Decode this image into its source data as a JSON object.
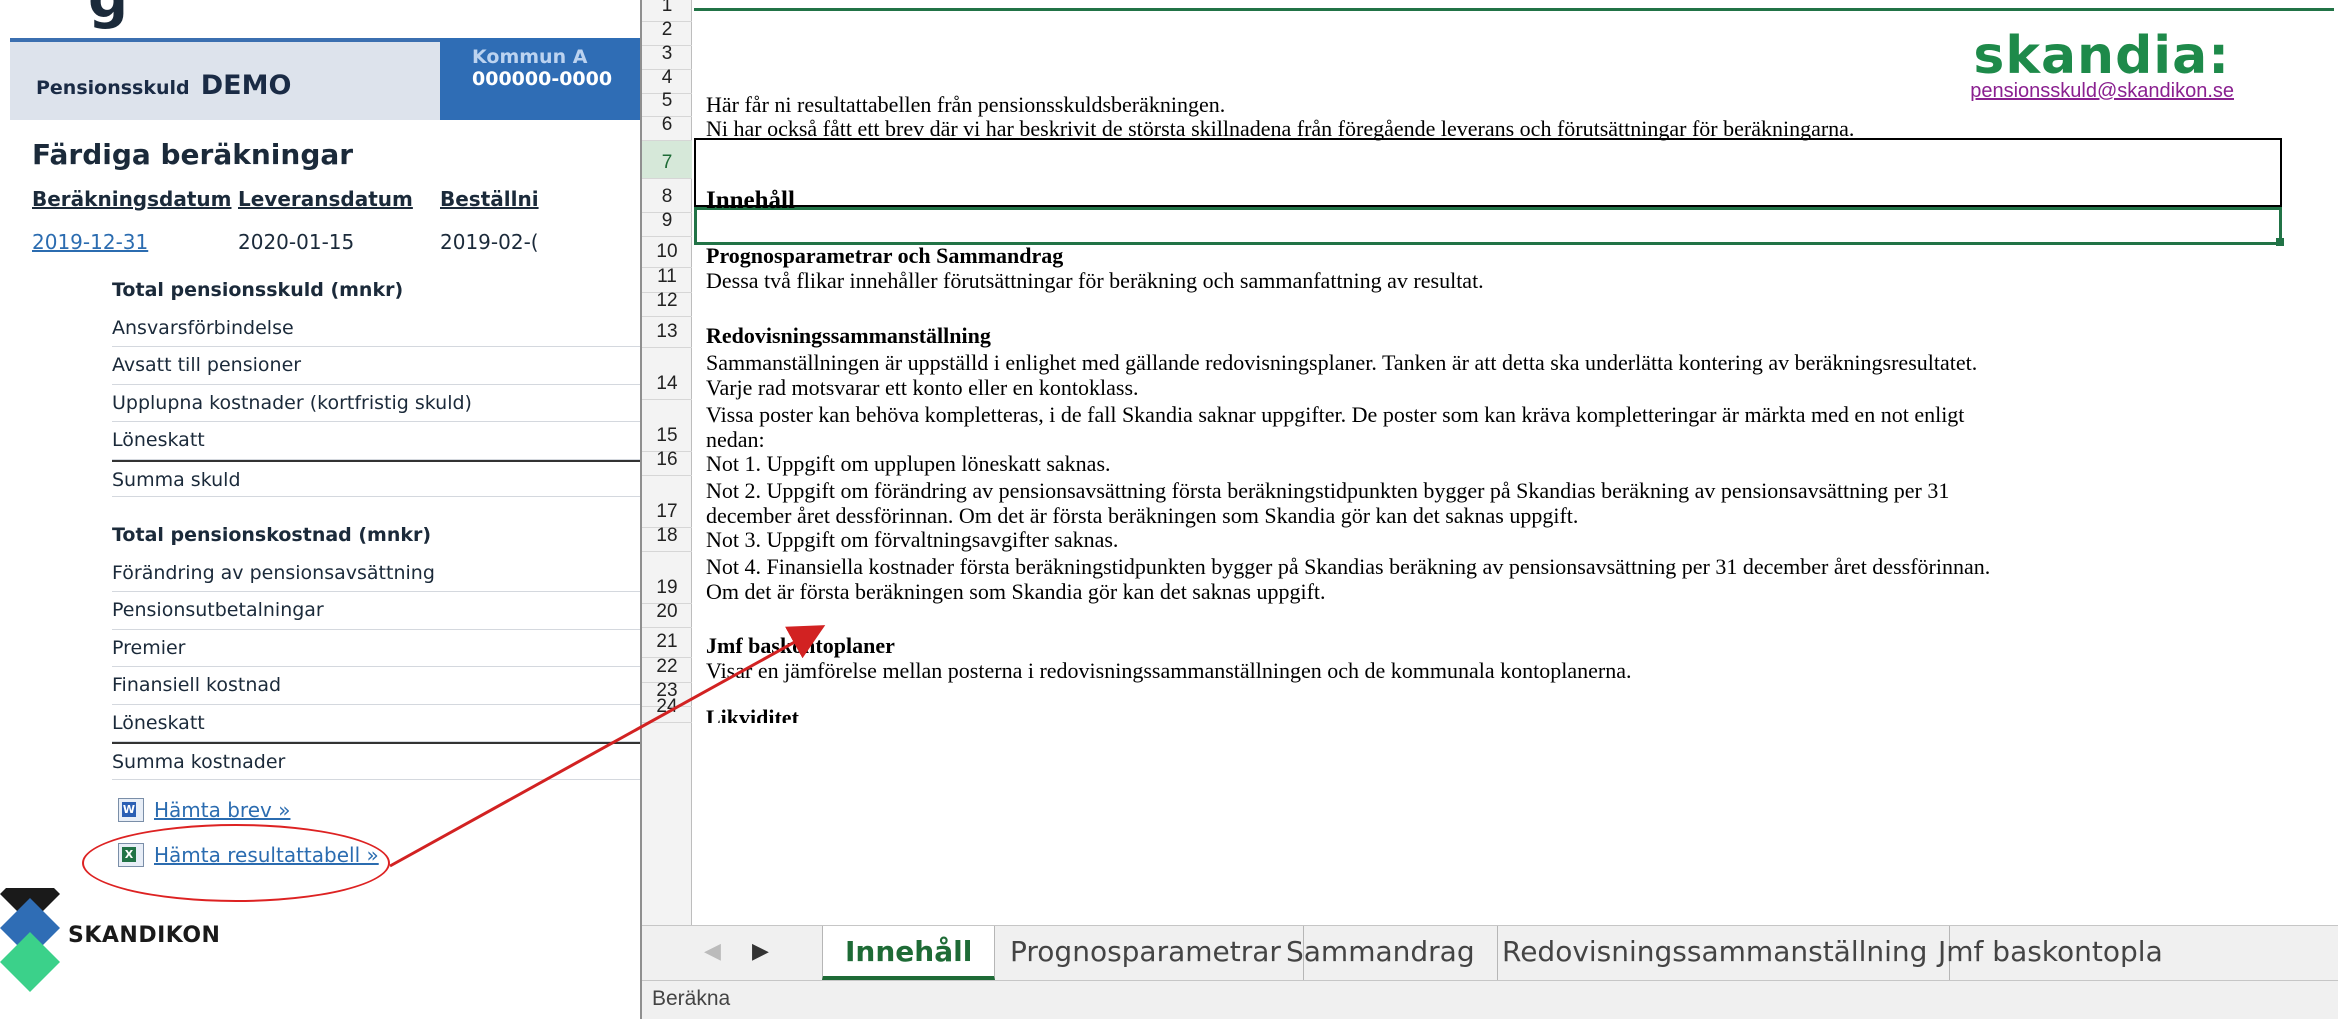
{
  "app": {
    "header_small": "Pensionsskuld",
    "header_large": "DEMO",
    "tab_muni": "Kommun A",
    "tab_id": "000000-0000",
    "section_title": "Färdiga beräkningar",
    "columns": [
      "Beräkningsdatum",
      "Leveransdatum",
      "Beställni"
    ],
    "row": {
      "calc_date": "2019-12-31",
      "delivery_date": "2020-01-15",
      "order_date": "2019-02-("
    },
    "debt": {
      "title": "Total pensionsskuld (mnkr)",
      "items": [
        "Ansvarsförbindelse",
        "Avsatt till pensioner",
        "Upplupna kostnader (kortfristig skuld)",
        "Löneskatt"
      ],
      "total": "Summa skuld"
    },
    "cost": {
      "title": "Total pensionskostnad (mnkr)",
      "items": [
        "Förändring av pensionsavsättning",
        "Pensionsutbetalningar",
        "Premier",
        "Finansiell kostnad",
        "Löneskatt"
      ],
      "total": "Summa kostnader"
    },
    "link_letter": "Hämta brev »",
    "link_table": "Hämta resultattabell »",
    "company_logo_text": "SKANDIKON"
  },
  "sheet": {
    "brand": "skandia:",
    "email": "pensionsskuld@skandikon.se",
    "rows": [
      {
        "n": "1",
        "text": ""
      },
      {
        "n": "2",
        "text": ""
      },
      {
        "n": "3",
        "text": ""
      },
      {
        "n": "4",
        "text": ""
      },
      {
        "n": "5",
        "text": "Här får ni resultattabellen från pensionsskuldsberäkningen."
      },
      {
        "n": "6",
        "text": "Ni har också fått ett brev där vi har beskrivit de största skillnadena från föregående leverans och förutsättningar för beräkningarna."
      },
      {
        "n": "7",
        "text": ""
      },
      {
        "n": "8",
        "text": "Innehåll"
      },
      {
        "n": "9",
        "text": ""
      },
      {
        "n": "10",
        "text": "Prognosparametrar och Sammandrag"
      },
      {
        "n": "11",
        "text": "Dessa två flikar innehåller förutsättningar för beräkning och sammanfattning av resultat."
      },
      {
        "n": "12",
        "text": ""
      },
      {
        "n": "13",
        "text": "Redovisningssammanställning"
      },
      {
        "n": "14",
        "line1": "Sammanställningen är uppställd i enlighet med gällande redovisningsplaner. Tanken är att detta ska underlätta kontering av beräkningsresultatet.",
        "text": "Varje rad motsvarar ett konto eller en kontoklass."
      },
      {
        "n": "15",
        "line1": "Vissa poster kan behöva kompletteras, i de fall Skandia saknar uppgifter. De poster som kan kräva kompletteringar är märkta med en not enligt",
        "text": "nedan:"
      },
      {
        "n": "16",
        "text": "Not 1. Uppgift om upplupen löneskatt saknas."
      },
      {
        "n": "17",
        "line1": "Not 2. Uppgift om förändring av pensionsavsättning första beräkningstidpunkten bygger på Skandias beräkning av pensionsavsättning per 31",
        "text": "december året dessförinnan. Om det är första beräkningen som Skandia gör kan det saknas uppgift."
      },
      {
        "n": "18",
        "text": "Not 3. Uppgift om förvaltningsavgifter saknas."
      },
      {
        "n": "19",
        "line1": "Not 4. Finansiella kostnader första beräkningstidpunkten bygger på Skandias beräkning av pensionsavsättning per 31 december året dessförinnan.",
        "text": "Om det är första beräkningen som Skandia gör kan det saknas uppgift."
      },
      {
        "n": "20",
        "text": ""
      },
      {
        "n": "21",
        "text": "Jmf baskontoplaner"
      },
      {
        "n": "22",
        "text": "Visar en jämförelse mellan posterna i redovisningssammanställningen och de kommunala kontoplanerna."
      },
      {
        "n": "23",
        "text": ""
      },
      {
        "n": "24",
        "text": "Likviditet"
      }
    ],
    "tabs": [
      "Innehåll",
      "Prognosparametrar",
      "Sammandrag",
      "Redovisningssammanställning",
      "Jmf baskontopla"
    ],
    "active_tab": "Innehåll",
    "status": "Beräkna"
  },
  "colors": {
    "accent_blue": "#2f6db5",
    "excel_green": "#217346",
    "brand_green": "#1e8a4a",
    "highlight_red": "#d22222"
  },
  "icons": [
    "word-icon",
    "excel-icon",
    "nav-prev-icon",
    "nav-next-icon"
  ]
}
